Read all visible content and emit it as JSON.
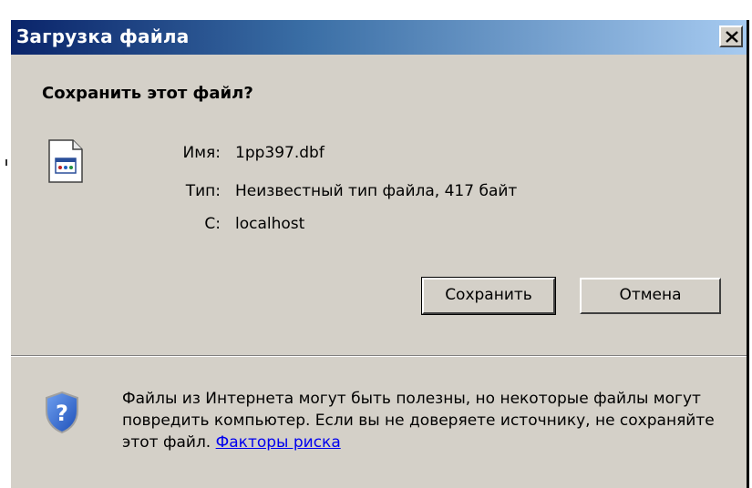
{
  "window": {
    "title": "Загрузка файла",
    "close_symbol": "×"
  },
  "dialog": {
    "question": "Сохранить этот файл?",
    "file_icon": "document-icon",
    "info": [
      {
        "label": "Имя:",
        "value": "1pp397.dbf"
      },
      {
        "label": "Тип:",
        "value": "Неизвестный тип файла, 417 байт"
      },
      {
        "label": "С:",
        "value": "localhost"
      }
    ],
    "buttons": {
      "save_label": "Сохранить",
      "cancel_label": "Отмена"
    },
    "warning": {
      "icon": "security-shield-question-icon",
      "text": "Файлы из Интернета могут быть полезны, но некоторые файлы могут повредить компьютер. Если вы не доверяете источнику, не сохраняйте этот файл.",
      "link_label": "Факторы риска"
    }
  },
  "colors": {
    "titlebar_start": "#0a246a",
    "titlebar_end": "#a6caf0",
    "dialog_bg": "#d4d0c8",
    "link": "#0000ee"
  }
}
